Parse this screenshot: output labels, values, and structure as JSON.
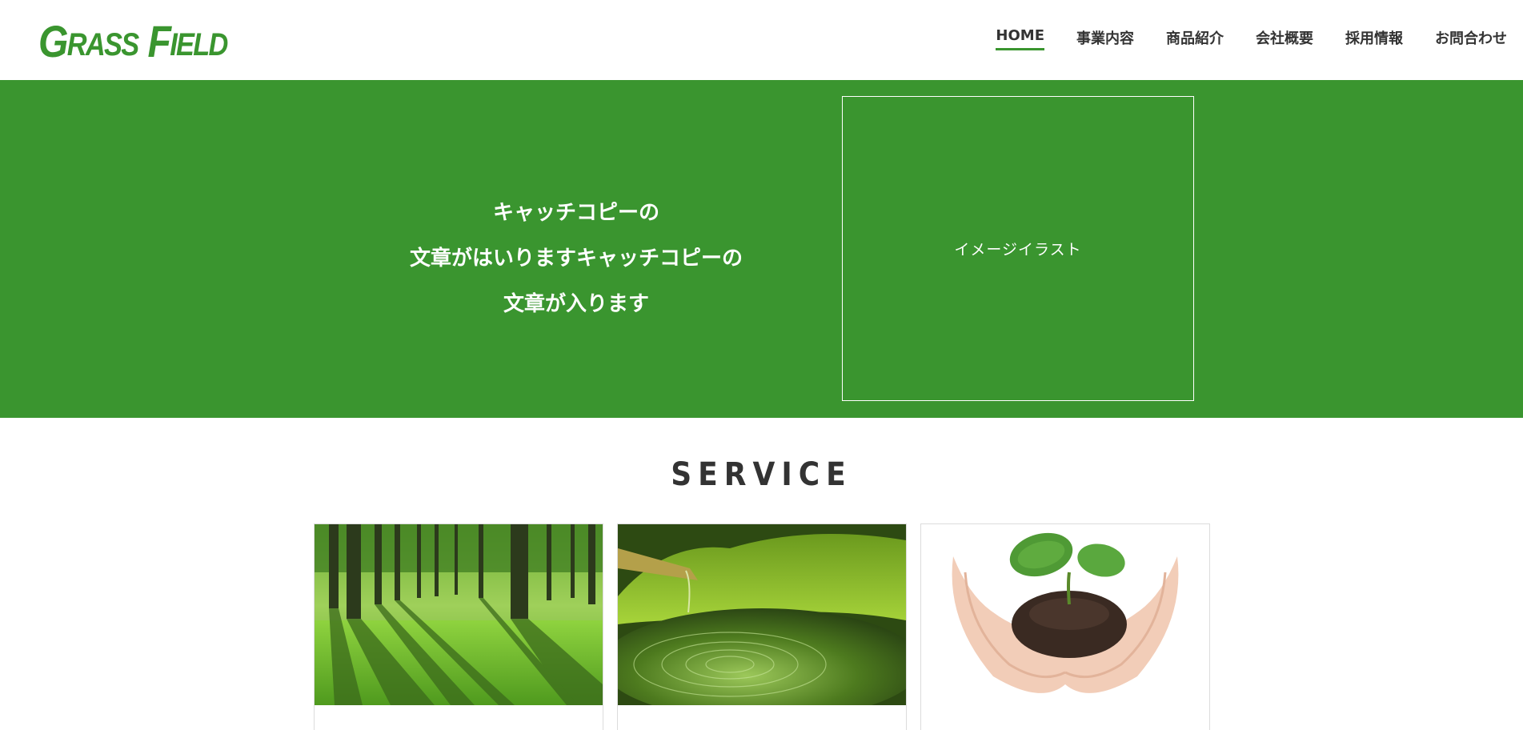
{
  "header": {
    "logo": {
      "first_cap": "G",
      "first_rest": "RASS",
      "second_cap": "F",
      "second_rest": "IELD"
    },
    "nav": [
      {
        "label": "HOME",
        "active": true
      },
      {
        "label": "事業内容"
      },
      {
        "label": "商品紹介"
      },
      {
        "label": "会社概要"
      },
      {
        "label": "採用情報"
      },
      {
        "label": "お問合わせ"
      }
    ]
  },
  "hero": {
    "catch_lines": [
      "キャッチコピーの",
      "文章がはいりますキャッチコピーの",
      "文章が入ります"
    ],
    "illust_label": "イメージイラスト"
  },
  "service": {
    "title": "SERVICE",
    "cards": [
      {
        "image": "forest-image"
      },
      {
        "image": "moss-water-image"
      },
      {
        "image": "seedling-hands-image"
      }
    ]
  },
  "colors": {
    "brand_green": "#3a952f",
    "text": "#333333",
    "white": "#ffffff"
  }
}
